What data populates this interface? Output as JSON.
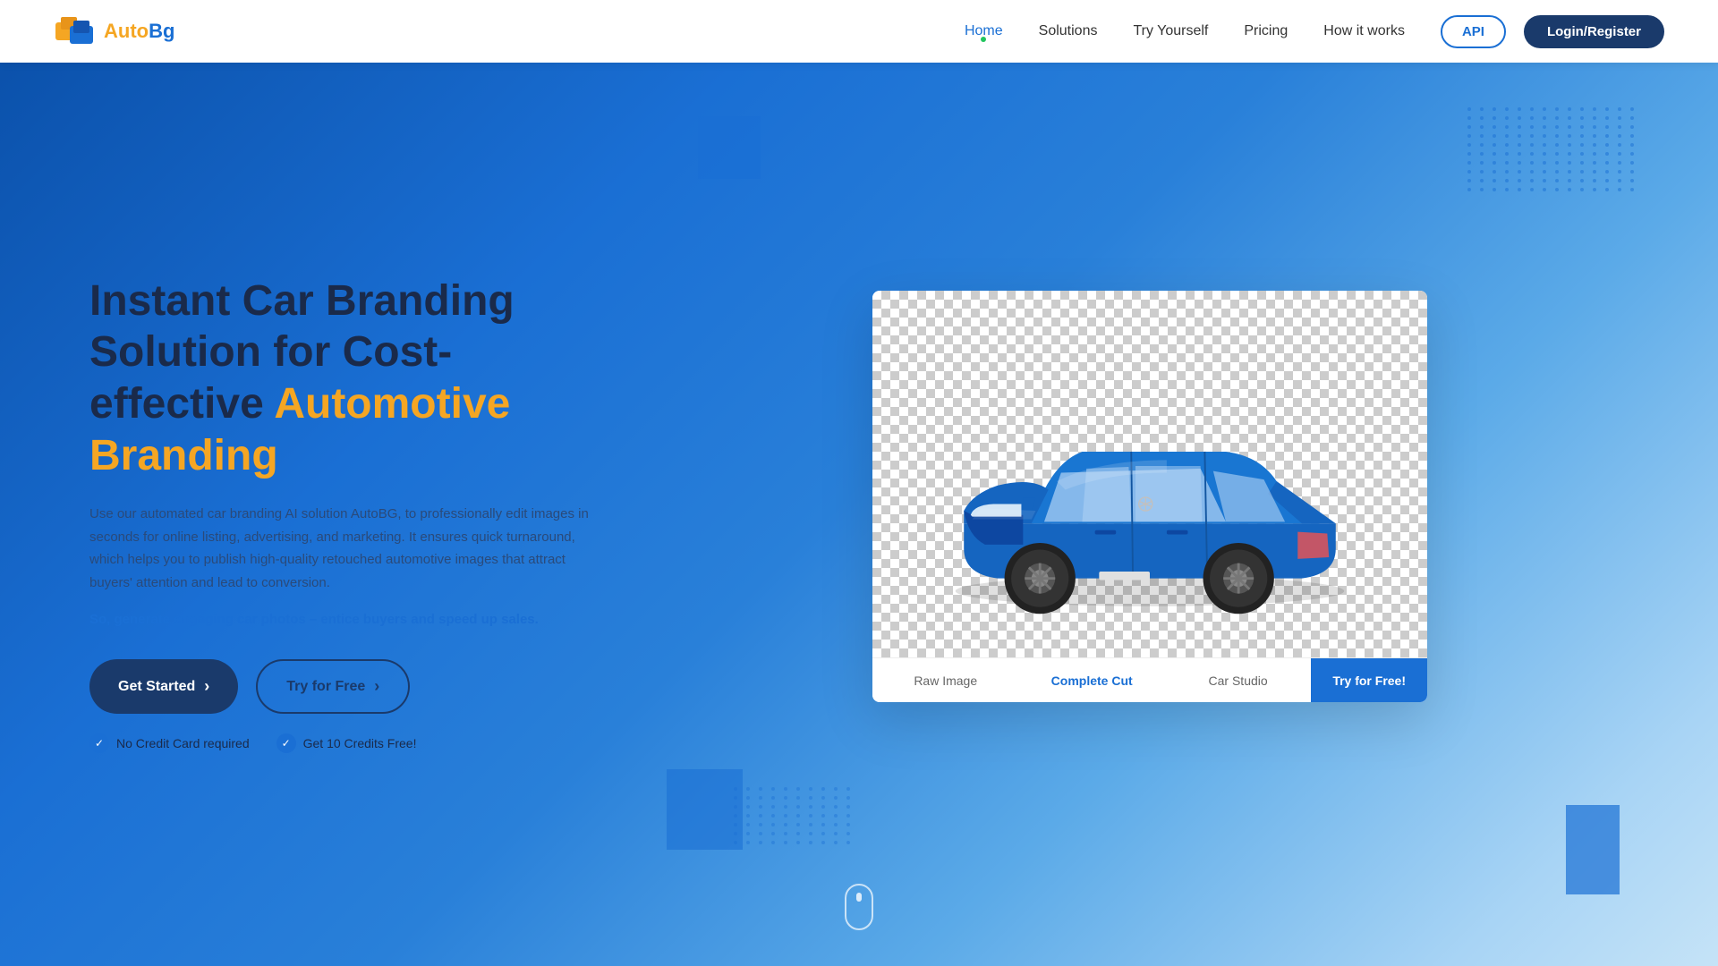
{
  "brand": {
    "name_part1": "Auto",
    "name_part2": "Bg"
  },
  "navbar": {
    "links": [
      {
        "label": "Home",
        "active": true,
        "id": "home"
      },
      {
        "label": "Solutions",
        "active": false,
        "id": "solutions"
      },
      {
        "label": "Try Yourself",
        "active": false,
        "id": "try-yourself"
      },
      {
        "label": "Pricing",
        "active": false,
        "id": "pricing"
      },
      {
        "label": "How it works",
        "active": false,
        "id": "how-it-works"
      }
    ],
    "api_btn": "API",
    "login_btn": "Login/Register"
  },
  "hero": {
    "title_line1": "Instant Car Branding Solution for Cost-",
    "title_line2_plain": "effective ",
    "title_line2_highlight": "Automotive Branding",
    "description": "Use our automated car branding AI solution AutoBG, to professionally edit images in seconds for online listing, advertising, and marketing. It ensures quick turnaround, which helps you to publish high-quality retouched automotive images that attract buyers' attention and lead to conversion.",
    "cta_text_plain": "So, generate engaging car photos – ",
    "cta_text_highlight": "entice buyers and speed up sales.",
    "btn_get_started": "Get Started",
    "btn_try_free": "Try for Free",
    "badge1": "No Credit Card required",
    "badge2": "Get 10 Credits Free!"
  },
  "image_tabs": {
    "tabs": [
      {
        "label": "Raw Image",
        "active": false
      },
      {
        "label": "Complete Cut",
        "active": true
      },
      {
        "label": "Car Studio",
        "active": false
      }
    ],
    "try_btn": "Try for Free!"
  },
  "colors": {
    "primary": "#1a6fd4",
    "dark_blue": "#1a3a6b",
    "orange": "#f5a623",
    "white": "#ffffff"
  }
}
